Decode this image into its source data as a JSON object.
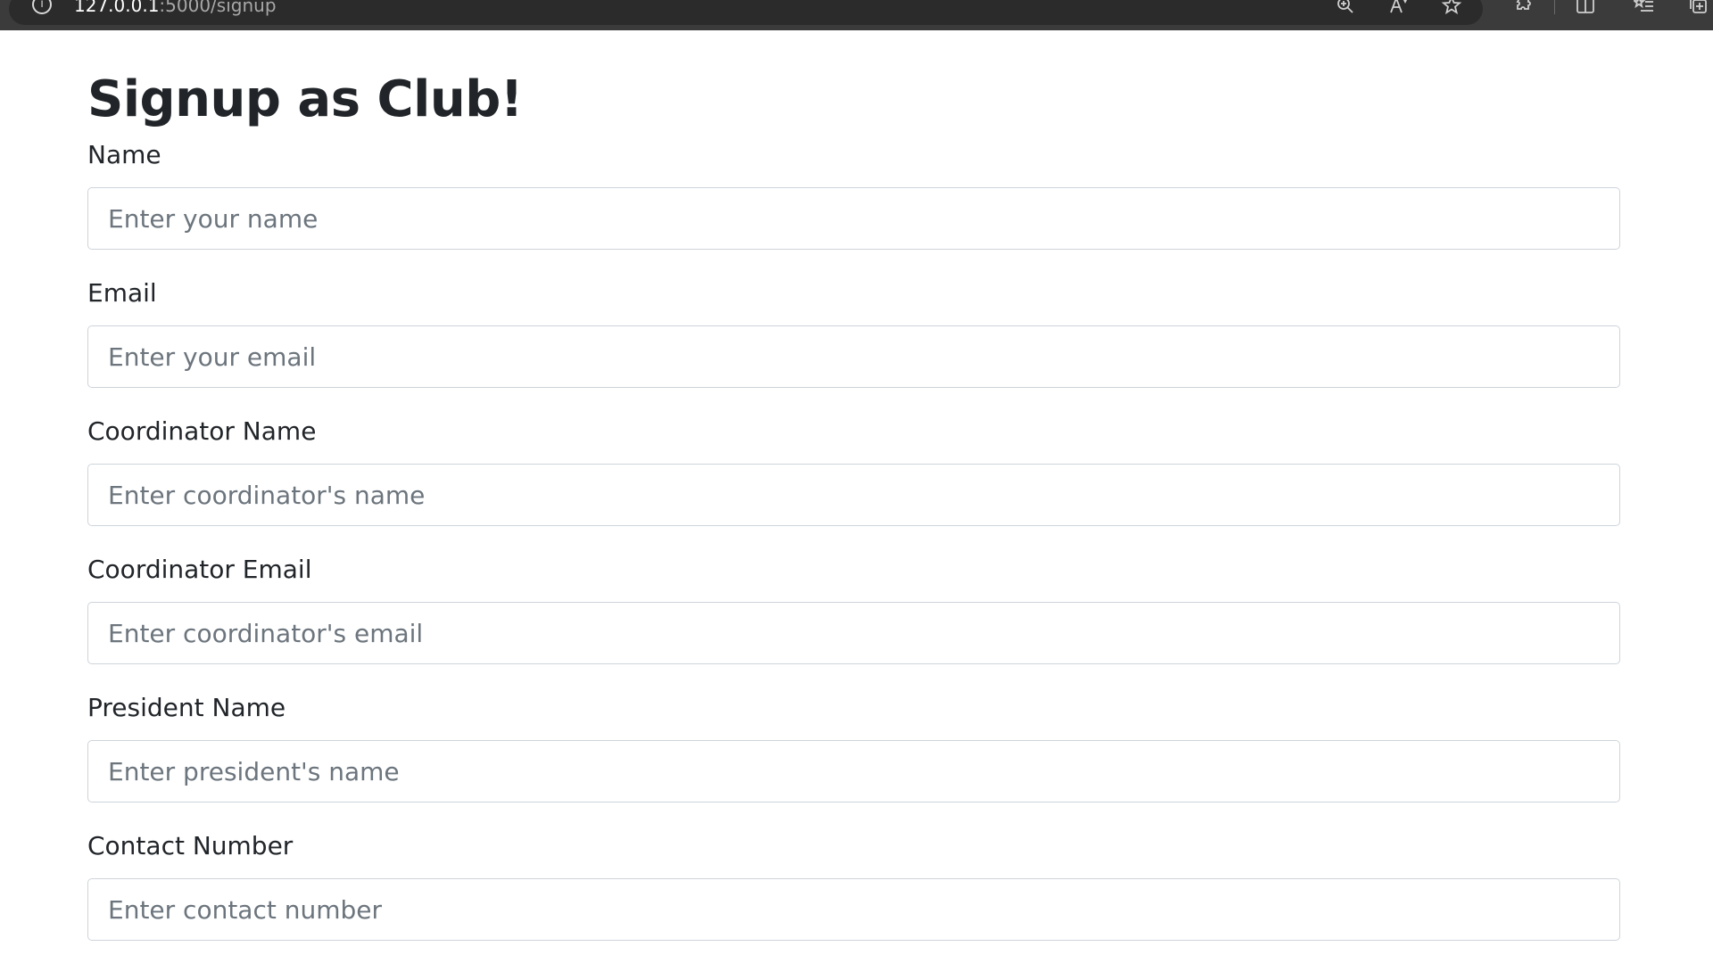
{
  "browser": {
    "url_host": "127.0.0.1",
    "url_rest": ":5000/signup",
    "info_icon": "info-icon",
    "toolbar_icons": [
      "zoom-icon",
      "read-aloud-icon",
      "favorite-star-icon",
      "extensions-icon",
      "split-screen-icon",
      "favorites-list-icon",
      "collections-icon"
    ]
  },
  "page": {
    "title": "Signup as Club!"
  },
  "form": {
    "fields": [
      {
        "label": "Name",
        "placeholder": "Enter your name",
        "value": ""
      },
      {
        "label": "Email",
        "placeholder": "Enter your email",
        "value": ""
      },
      {
        "label": "Coordinator Name",
        "placeholder": "Enter coordinator's name",
        "value": ""
      },
      {
        "label": "Coordinator Email",
        "placeholder": "Enter coordinator's email",
        "value": ""
      },
      {
        "label": "President Name",
        "placeholder": "Enter president's name",
        "value": ""
      },
      {
        "label": "Contact Number",
        "placeholder": "Enter contact number",
        "value": ""
      }
    ]
  }
}
